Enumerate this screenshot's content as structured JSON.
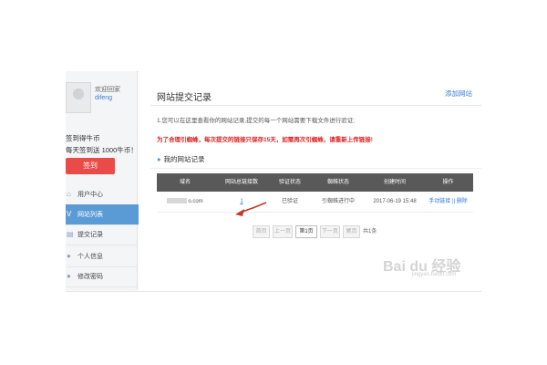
{
  "user": {
    "welcome": "欢迎回家",
    "name": "difeng"
  },
  "signin": {
    "line1": "签到得牛币",
    "line2": "每天签到送 1000牛币！",
    "button": "签到"
  },
  "sidebar": {
    "items": [
      {
        "icon": "home-icon",
        "label": "用户中心"
      },
      {
        "icon": "list-icon",
        "label": "网站列表"
      },
      {
        "icon": "submit-icon",
        "label": "提交记录"
      },
      {
        "icon": "person-icon",
        "label": "个人信息"
      },
      {
        "icon": "person-icon",
        "label": "修改密码"
      }
    ]
  },
  "main": {
    "title": "网站提交记录",
    "add_link": "添加网站",
    "note1": "1.您可以在这里查看你的网站记录,提交的每一个网站需要下载文件进行验证;",
    "note2": "为了合理引蜘蛛，每次提交的链接只保存15天，如需再次引蜘蛛，请重新上传链接!",
    "section_title": "我的网站记录"
  },
  "table": {
    "headers": [
      "域名",
      "网站总链接数",
      "验证状态",
      "蜘蛛状态",
      "创建时间",
      "操作"
    ],
    "rows": [
      {
        "domain": "o.com",
        "links": "1",
        "verify": "已验证",
        "spider": "引蜘蛛进行中",
        "created": "2017-06-19 15:48",
        "op_link": "手动链接",
        "op_sep": "||",
        "op_delete": "删除"
      }
    ]
  },
  "pagination": {
    "first": "首页",
    "prev": "上一页",
    "current": "第1页",
    "next": "下一页",
    "last": "尾页",
    "total": "共1条"
  },
  "watermark": {
    "main": "Bai du 经验",
    "sub": "jingyan.baidu.com"
  },
  "colors": {
    "accent": "#5b9bd5",
    "danger": "#e94b48",
    "link": "#3a7bd5",
    "table_header": "#595959"
  }
}
